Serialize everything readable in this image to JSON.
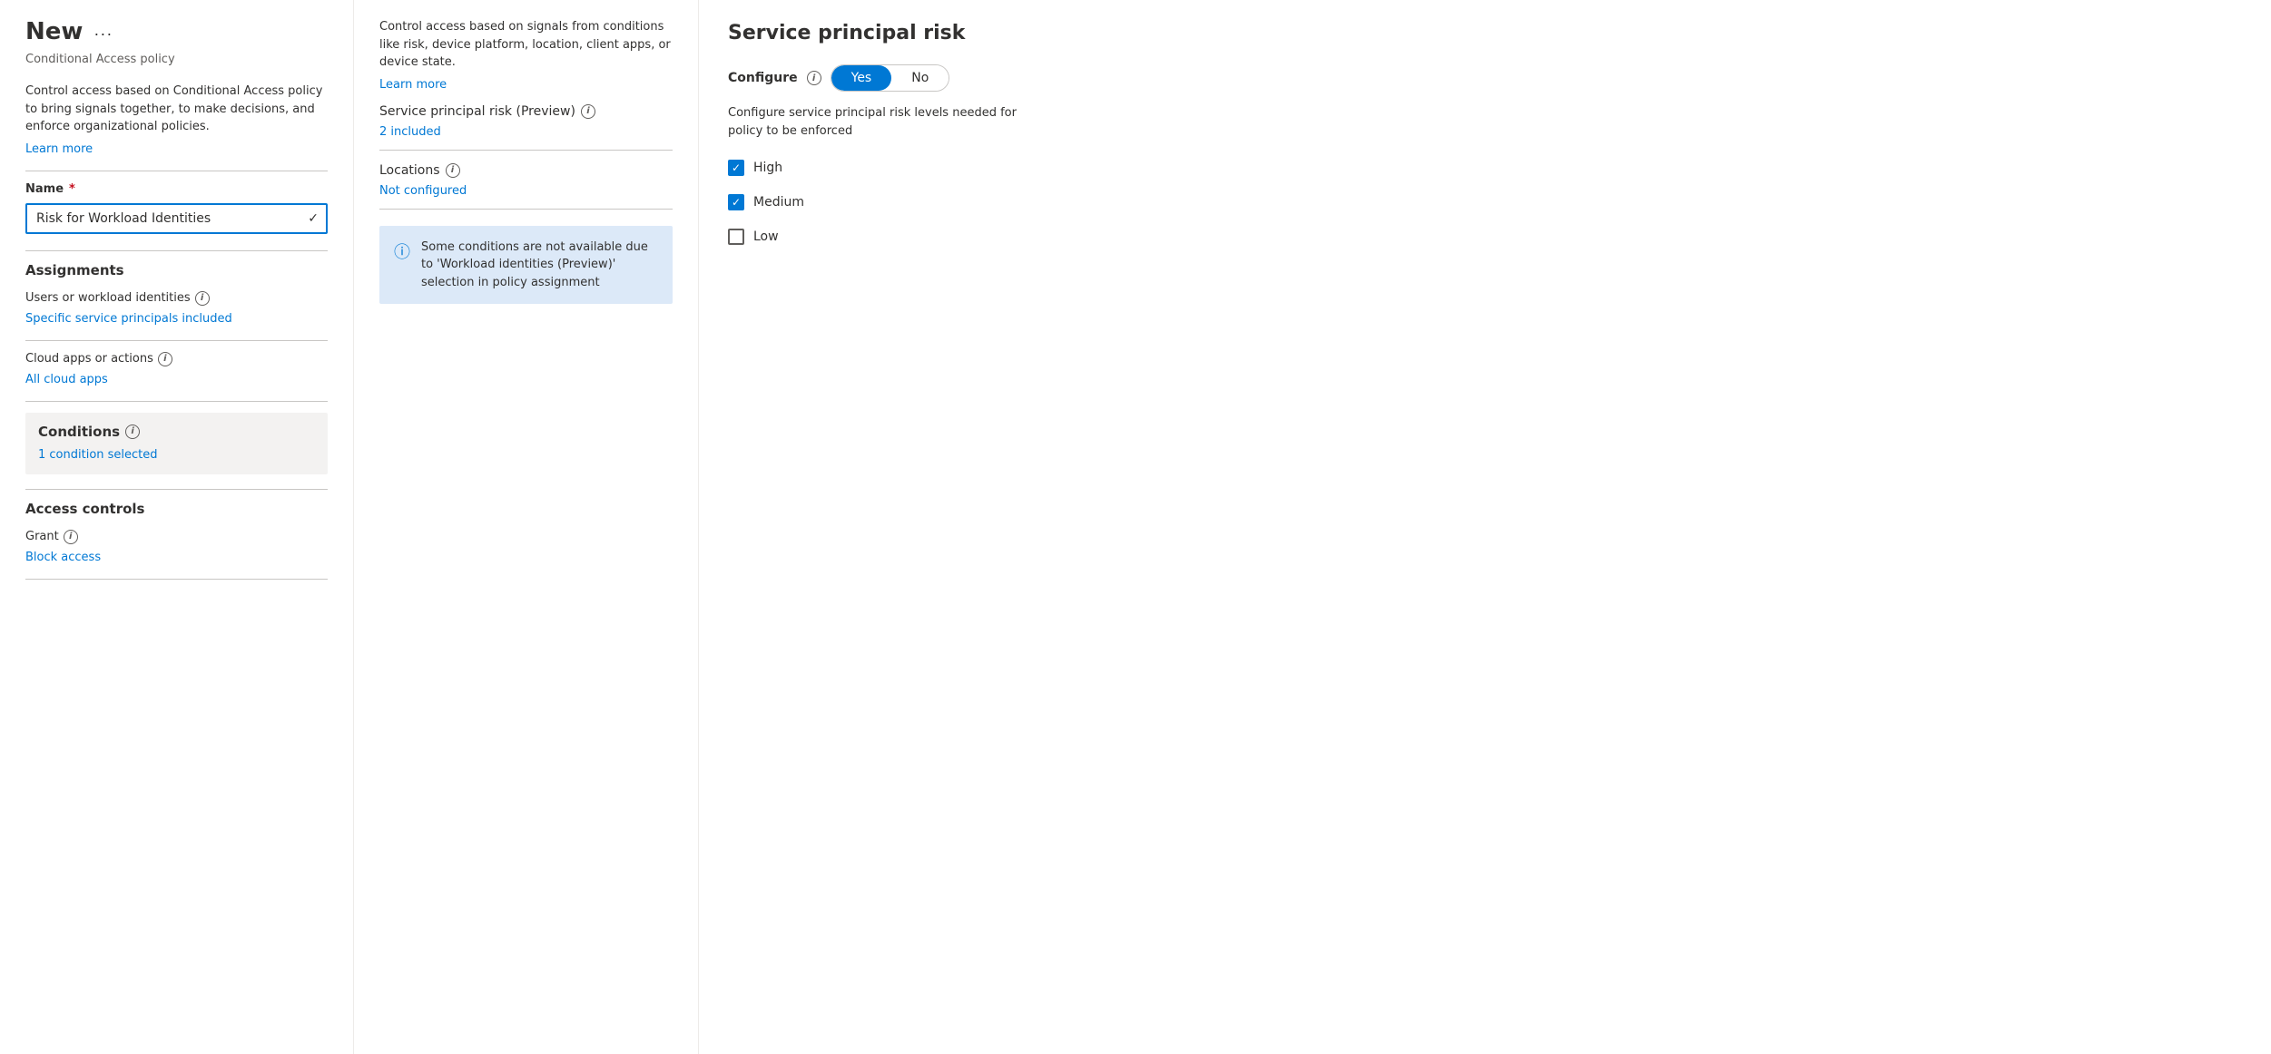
{
  "left_panel": {
    "title": "New",
    "title_ellipsis": "···",
    "subtitle": "Conditional Access policy",
    "description": "Control access based on Conditional Access policy to bring signals together, to make decisions, and enforce organizational policies.",
    "learn_more": "Learn more",
    "name_label": "Name",
    "name_value": "Risk for Workload Identities",
    "assignments_header": "Assignments",
    "users_label": "Users or workload identities",
    "users_value": "Specific service principals included",
    "cloud_apps_label": "Cloud apps or actions",
    "cloud_apps_value": "All cloud apps",
    "conditions_header": "Conditions",
    "conditions_value": "1 condition selected",
    "access_controls_header": "Access controls",
    "grant_label": "Grant",
    "grant_value": "Block access"
  },
  "middle_panel": {
    "description": "Control access based on signals from conditions like risk, device platform, location, client apps, or device state.",
    "learn_more": "Learn more",
    "service_principal_risk_label": "Service principal risk (Preview)",
    "service_principal_risk_value": "2 included",
    "locations_label": "Locations",
    "locations_value": "Not configured",
    "info_box_text": "Some conditions are not available due to 'Workload identities (Preview)' selection in policy assignment"
  },
  "right_panel": {
    "title": "Service principal risk",
    "configure_label": "Configure",
    "yes_label": "Yes",
    "no_label": "No",
    "configure_description": "Configure service principal risk levels needed for policy to be enforced",
    "checkboxes": [
      {
        "label": "High",
        "checked": true
      },
      {
        "label": "Medium",
        "checked": true
      },
      {
        "label": "Low",
        "checked": false
      }
    ]
  },
  "icons": {
    "info": "i",
    "check": "✓",
    "info_circle_filled": "ℹ"
  }
}
